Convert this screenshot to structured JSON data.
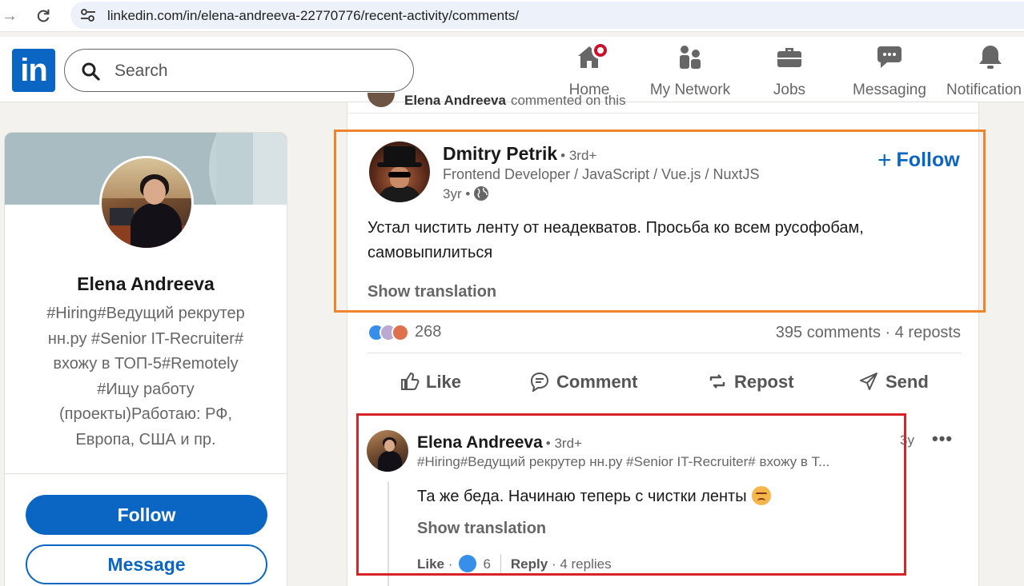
{
  "browser": {
    "url": "linkedin.com/in/elena-andreeva-22770776/recent-activity/comments/"
  },
  "header": {
    "logo_text": "in",
    "search_placeholder": "Search",
    "nav": [
      {
        "label": "Home",
        "icon": "home-icon"
      },
      {
        "label": "My Network",
        "icon": "network-icon"
      },
      {
        "label": "Jobs",
        "icon": "briefcase-icon"
      },
      {
        "label": "Messaging",
        "icon": "messaging-icon"
      },
      {
        "label": "Notification",
        "icon": "bell-icon"
      }
    ]
  },
  "profile": {
    "name": "Elena Andreeva",
    "headline": "#Hiring#Ведущий рекрутер нн.ру #Senior IT-Recruiter# вхожу в ТОП-5#Remotely #Ищу работу (проекты)Работаю: РФ, Европа, США и пр.",
    "follow_label": "Follow",
    "message_label": "Message"
  },
  "previous_activity": {
    "name": "Elena Andreeva",
    "text": "commented on this"
  },
  "post": {
    "author": "Dmitry Petrik",
    "degree": "• 3rd+",
    "subtitle": "Frontend Developer / JavaScript / Vue.js / NuxtJS",
    "time": "3yr •",
    "follow_label": "Follow",
    "text": "Устал чистить ленту от неадекватов. Просьба ко всем русофобам, самовыпилиться",
    "translate_label": "Show translation",
    "reaction_count": "268",
    "stats": "395 comments · 4 reposts",
    "actions": [
      {
        "label": "Like",
        "icon": "like-icon"
      },
      {
        "label": "Comment",
        "icon": "comment-icon"
      },
      {
        "label": "Repost",
        "icon": "repost-icon"
      },
      {
        "label": "Send",
        "icon": "send-icon"
      }
    ]
  },
  "comment": {
    "author": "Elena Andreeva",
    "degree": "• 3rd+",
    "headline": "#Hiring#Ведущий рекрутер нн.ру #Senior IT-Recruiter# вхожу в Т...",
    "time": "3y",
    "more": "•••",
    "text": "Та же беда. Начинаю теперь с чистки ленты",
    "translate_label": "Show translation",
    "like_label": "Like",
    "like_sep": "·",
    "like_count": "6",
    "reply_label": "Reply",
    "replies": "· 4 replies"
  },
  "colors": {
    "brand": "#0a66c2",
    "highlight_orange": "#f0842c",
    "highlight_red": "#d92128",
    "notification": "#cb112d"
  }
}
